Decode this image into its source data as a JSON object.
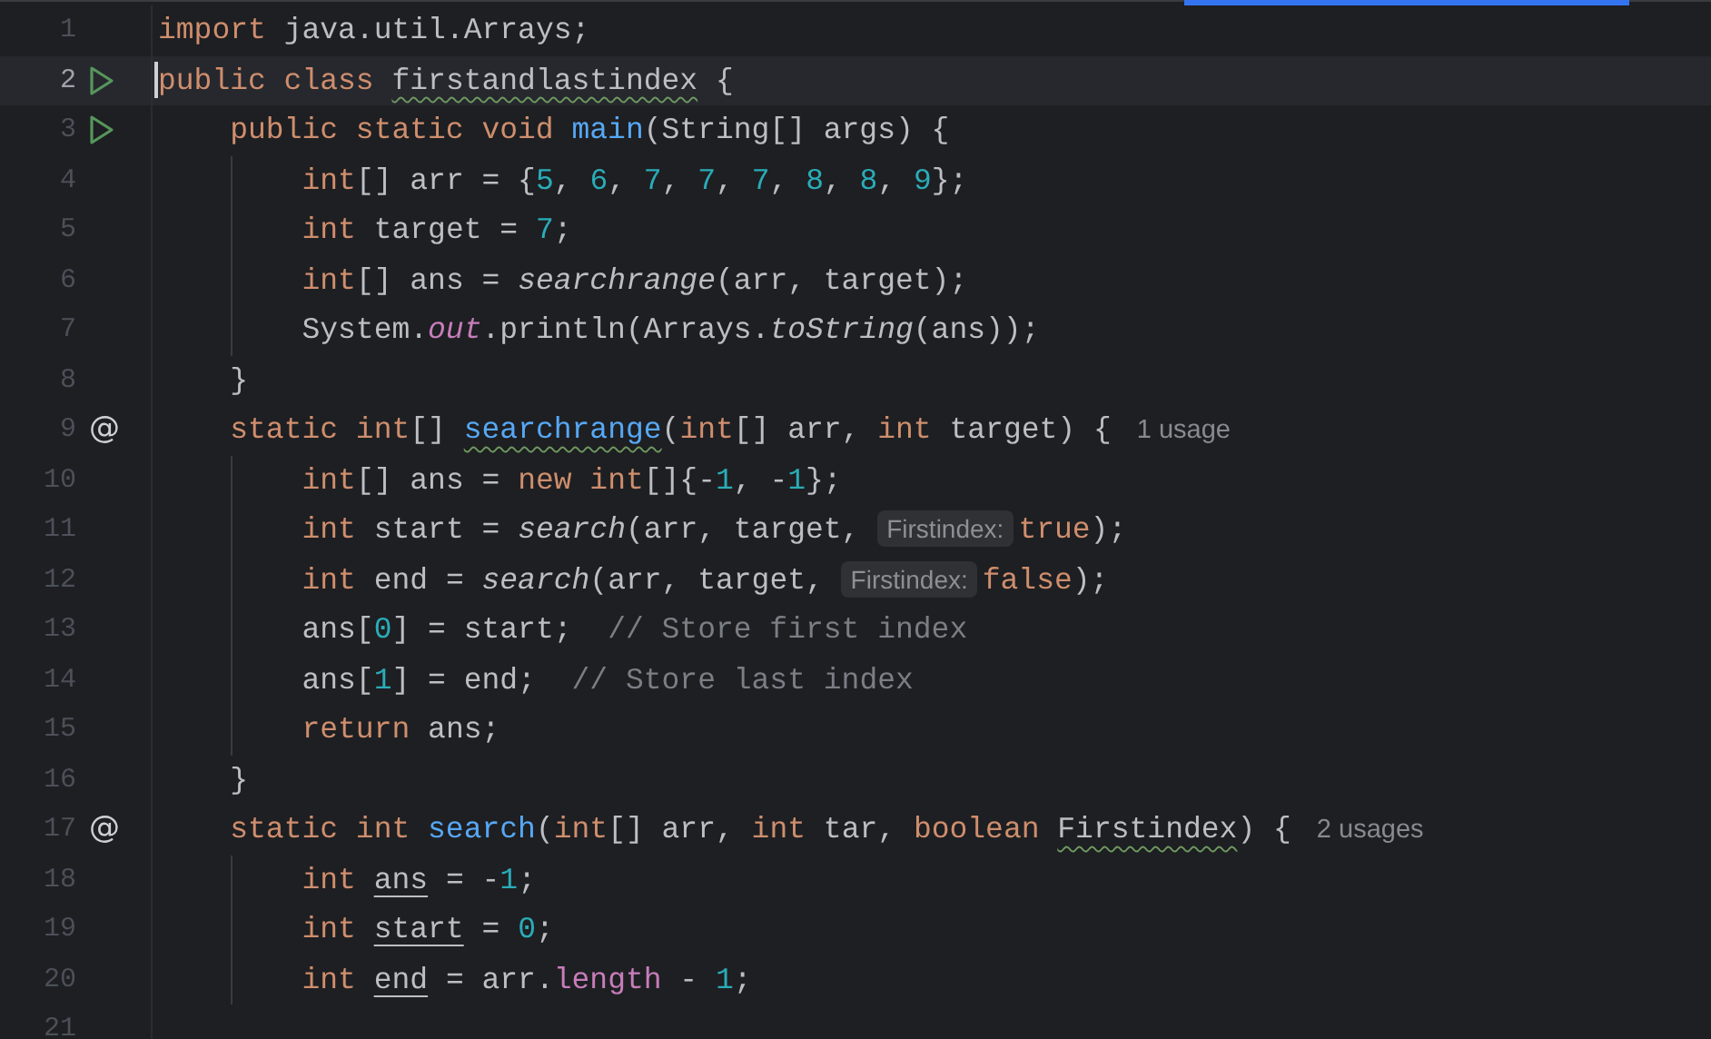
{
  "editor": {
    "lines": [
      {
        "number": "1",
        "current": false,
        "tokens": [
          {
            "kind": "keyword",
            "text": "import"
          },
          {
            "kind": "plain",
            "text": " java.util.Arrays;"
          }
        ]
      },
      {
        "number": "2",
        "current": true,
        "gutter": {
          "kind": "run"
        },
        "tokens": [
          {
            "kind": "keyword",
            "text": "public class "
          },
          {
            "kind": "plain",
            "text": "firstandlastindex",
            "typo": true
          },
          {
            "kind": "plain",
            "text": " {"
          }
        ]
      },
      {
        "number": "3",
        "current": false,
        "gutter": {
          "kind": "run"
        },
        "tokens": [
          {
            "kind": "keyword",
            "text": "    public static void "
          },
          {
            "kind": "declaration",
            "text": "main"
          },
          {
            "kind": "plain",
            "text": "(String[] args) {"
          }
        ]
      },
      {
        "number": "4",
        "current": false,
        "tokens": [
          {
            "kind": "keyword",
            "text": "        int"
          },
          {
            "kind": "plain",
            "text": "[] arr = {"
          },
          {
            "kind": "number",
            "text": "5"
          },
          {
            "kind": "plain",
            "text": ", "
          },
          {
            "kind": "number",
            "text": "6"
          },
          {
            "kind": "plain",
            "text": ", "
          },
          {
            "kind": "number",
            "text": "7"
          },
          {
            "kind": "plain",
            "text": ", "
          },
          {
            "kind": "number",
            "text": "7"
          },
          {
            "kind": "plain",
            "text": ", "
          },
          {
            "kind": "number",
            "text": "7"
          },
          {
            "kind": "plain",
            "text": ", "
          },
          {
            "kind": "number",
            "text": "8"
          },
          {
            "kind": "plain",
            "text": ", "
          },
          {
            "kind": "number",
            "text": "8"
          },
          {
            "kind": "plain",
            "text": ", "
          },
          {
            "kind": "number",
            "text": "9"
          },
          {
            "kind": "plain",
            "text": "};"
          }
        ]
      },
      {
        "number": "5",
        "current": false,
        "tokens": [
          {
            "kind": "keyword",
            "text": "        int"
          },
          {
            "kind": "plain",
            "text": " target = "
          },
          {
            "kind": "number",
            "text": "7"
          },
          {
            "kind": "plain",
            "text": ";"
          }
        ]
      },
      {
        "number": "6",
        "current": false,
        "tokens": [
          {
            "kind": "keyword",
            "text": "        int"
          },
          {
            "kind": "plain",
            "text": "[] ans = "
          },
          {
            "kind": "static_call",
            "text": "searchrange"
          },
          {
            "kind": "plain",
            "text": "(arr, target);"
          }
        ]
      },
      {
        "number": "7",
        "current": false,
        "tokens": [
          {
            "kind": "plain",
            "text": "        System."
          },
          {
            "kind": "static_field",
            "text": "out"
          },
          {
            "kind": "plain",
            "text": ".println(Arrays."
          },
          {
            "kind": "static_call",
            "text": "toString"
          },
          {
            "kind": "plain",
            "text": "(ans));"
          }
        ]
      },
      {
        "number": "8",
        "current": false,
        "tokens": [
          {
            "kind": "plain",
            "text": "    }"
          }
        ]
      },
      {
        "number": "9",
        "current": false,
        "gutter": {
          "kind": "mark",
          "text": "@"
        },
        "tokens": [
          {
            "kind": "keyword",
            "text": "    static int"
          },
          {
            "kind": "plain",
            "text": "[] "
          },
          {
            "kind": "declaration",
            "text": "searchrange",
            "typo": true
          },
          {
            "kind": "plain",
            "text": "("
          },
          {
            "kind": "keyword",
            "text": "int"
          },
          {
            "kind": "plain",
            "text": "[] arr, "
          },
          {
            "kind": "keyword",
            "text": "int"
          },
          {
            "kind": "plain",
            "text": " target) {"
          },
          {
            "kind": "usage",
            "text": "1 usage"
          }
        ]
      },
      {
        "number": "10",
        "current": false,
        "tokens": [
          {
            "kind": "keyword",
            "text": "        int"
          },
          {
            "kind": "plain",
            "text": "[] ans = "
          },
          {
            "kind": "keyword",
            "text": "new int"
          },
          {
            "kind": "plain",
            "text": "[]{-"
          },
          {
            "kind": "number",
            "text": "1"
          },
          {
            "kind": "plain",
            "text": ", -"
          },
          {
            "kind": "number",
            "text": "1"
          },
          {
            "kind": "plain",
            "text": "};"
          }
        ]
      },
      {
        "number": "11",
        "current": false,
        "tokens": [
          {
            "kind": "keyword",
            "text": "        int"
          },
          {
            "kind": "plain",
            "text": " start = "
          },
          {
            "kind": "static_call",
            "text": "search"
          },
          {
            "kind": "plain",
            "text": "(arr, target, "
          },
          {
            "kind": "hint",
            "text": "Firstindex:"
          },
          {
            "kind": "keyword",
            "text": "true"
          },
          {
            "kind": "plain",
            "text": ");"
          }
        ]
      },
      {
        "number": "12",
        "current": false,
        "tokens": [
          {
            "kind": "keyword",
            "text": "        int"
          },
          {
            "kind": "plain",
            "text": " end = "
          },
          {
            "kind": "static_call",
            "text": "search"
          },
          {
            "kind": "plain",
            "text": "(arr, target, "
          },
          {
            "kind": "hint",
            "text": "Firstindex:"
          },
          {
            "kind": "keyword",
            "text": "false"
          },
          {
            "kind": "plain",
            "text": ");"
          }
        ]
      },
      {
        "number": "13",
        "current": false,
        "tokens": [
          {
            "kind": "plain",
            "text": "        ans["
          },
          {
            "kind": "number",
            "text": "0"
          },
          {
            "kind": "plain",
            "text": "] = start;  "
          },
          {
            "kind": "comment",
            "text": "// Store first index"
          }
        ]
      },
      {
        "number": "14",
        "current": false,
        "tokens": [
          {
            "kind": "plain",
            "text": "        ans["
          },
          {
            "kind": "number",
            "text": "1"
          },
          {
            "kind": "plain",
            "text": "] = end;  "
          },
          {
            "kind": "comment",
            "text": "// Store last index"
          }
        ]
      },
      {
        "number": "15",
        "current": false,
        "tokens": [
          {
            "kind": "keyword",
            "text": "        return"
          },
          {
            "kind": "plain",
            "text": " ans;"
          }
        ]
      },
      {
        "number": "16",
        "current": false,
        "tokens": [
          {
            "kind": "plain",
            "text": "    }"
          }
        ]
      },
      {
        "number": "17",
        "current": false,
        "gutter": {
          "kind": "mark",
          "text": "@"
        },
        "tokens": [
          {
            "kind": "keyword",
            "text": "    static int "
          },
          {
            "kind": "declaration",
            "text": "search"
          },
          {
            "kind": "plain",
            "text": "("
          },
          {
            "kind": "keyword",
            "text": "int"
          },
          {
            "kind": "plain",
            "text": "[] arr, "
          },
          {
            "kind": "keyword",
            "text": "int"
          },
          {
            "kind": "plain",
            "text": " tar, "
          },
          {
            "kind": "keyword",
            "text": "boolean "
          },
          {
            "kind": "plain",
            "text": "Firstindex",
            "typo": true
          },
          {
            "kind": "plain",
            "text": ") {"
          },
          {
            "kind": "usage",
            "text": "2 usages"
          }
        ]
      },
      {
        "number": "18",
        "current": false,
        "tokens": [
          {
            "kind": "keyword",
            "text": "        int "
          },
          {
            "kind": "plain",
            "text": "ans",
            "reassigned": true
          },
          {
            "kind": "plain",
            "text": " = -"
          },
          {
            "kind": "number",
            "text": "1"
          },
          {
            "kind": "plain",
            "text": ";"
          }
        ]
      },
      {
        "number": "19",
        "current": false,
        "tokens": [
          {
            "kind": "keyword",
            "text": "        int "
          },
          {
            "kind": "plain",
            "text": "start",
            "reassigned": true
          },
          {
            "kind": "plain",
            "text": " = "
          },
          {
            "kind": "number",
            "text": "0"
          },
          {
            "kind": "plain",
            "text": ";"
          }
        ]
      },
      {
        "number": "20",
        "current": false,
        "tokens": [
          {
            "kind": "keyword",
            "text": "        int "
          },
          {
            "kind": "plain",
            "text": "end",
            "reassigned": true
          },
          {
            "kind": "plain",
            "text": " = arr."
          },
          {
            "kind": "field",
            "text": "length"
          },
          {
            "kind": "plain",
            "text": " - "
          },
          {
            "kind": "number",
            "text": "1"
          },
          {
            "kind": "plain",
            "text": ";"
          }
        ]
      },
      {
        "number": "21",
        "current": false
      }
    ]
  }
}
